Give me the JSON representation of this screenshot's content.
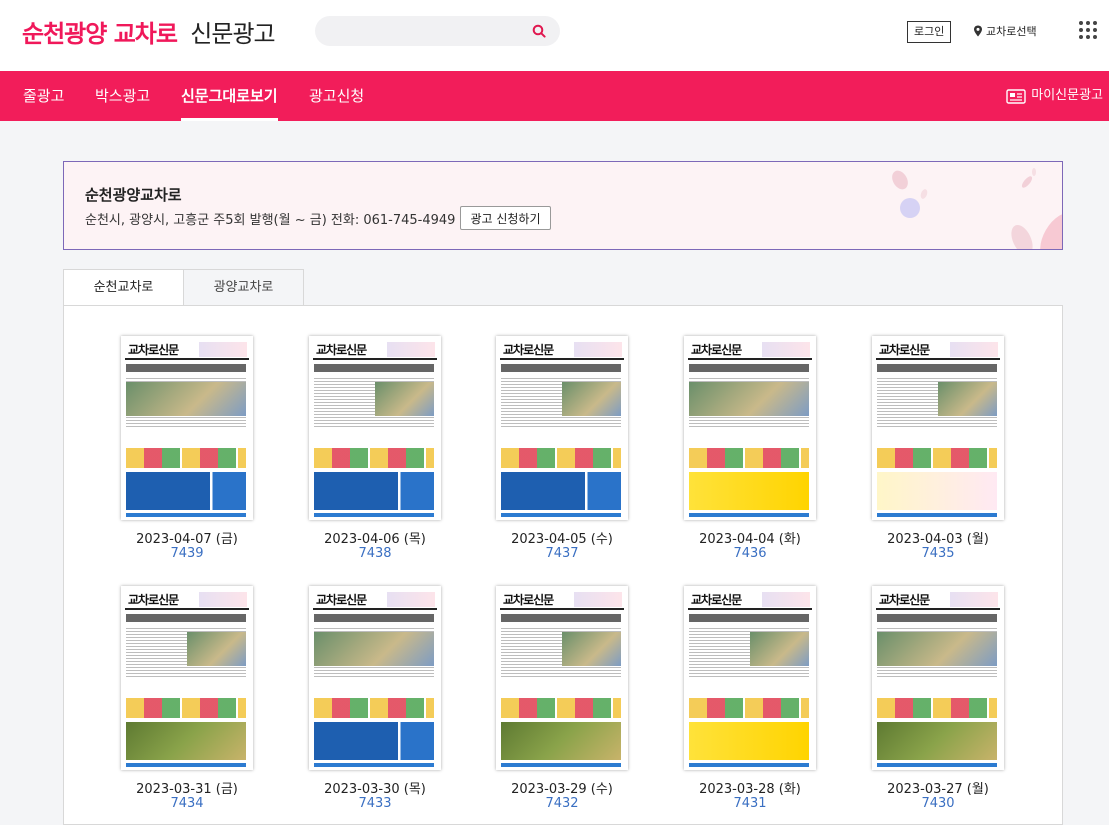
{
  "brand": {
    "part1": "순천광양",
    "part2": "교차로",
    "part3": "신문광고"
  },
  "search": {
    "placeholder": ""
  },
  "header": {
    "login_label": "로그인",
    "region_label": "교차로선택"
  },
  "nav": {
    "items": [
      "줄광고",
      "박스광고",
      "신문그대로보기",
      "광고신청"
    ],
    "active": "신문그대로보기",
    "my_ads_label": "마이신문광고"
  },
  "info": {
    "title": "순천광양교차로",
    "description": "순천시, 광양시, 고흥군 주5회 발행(월 ~ 금) 전화: 061-745-4949",
    "apply_label": "광고 신청하기"
  },
  "tabs": [
    {
      "label": "순천교차로",
      "active": true
    },
    {
      "label": "광양교차로",
      "active": false
    }
  ],
  "newspapers": [
    {
      "date": "2023-04-07 (금)",
      "issue": "7439",
      "masthead": "교차로신문",
      "ad_style": "blue"
    },
    {
      "date": "2023-04-06 (목)",
      "issue": "7438",
      "masthead": "교차로신문",
      "ad_style": "blue"
    },
    {
      "date": "2023-04-05 (수)",
      "issue": "7437",
      "masthead": "교차로신문",
      "ad_style": "blue"
    },
    {
      "date": "2023-04-04 (화)",
      "issue": "7436",
      "masthead": "교차로신문",
      "ad_style": "yel"
    },
    {
      "date": "2023-04-03 (월)",
      "issue": "7435",
      "masthead": "교차로신문",
      "ad_style": "fest"
    },
    {
      "date": "2023-03-31 (금)",
      "issue": "7434",
      "masthead": "교차로신문",
      "ad_style": "field"
    },
    {
      "date": "2023-03-30 (목)",
      "issue": "7433",
      "masthead": "교차로신문",
      "ad_style": "blue"
    },
    {
      "date": "2023-03-29 (수)",
      "issue": "7432",
      "masthead": "교차로신문",
      "ad_style": "field"
    },
    {
      "date": "2023-03-28 (화)",
      "issue": "7431",
      "masthead": "교차로신문",
      "ad_style": "yel"
    },
    {
      "date": "2023-03-27 (월)",
      "issue": "7430",
      "masthead": "교차로신문",
      "ad_style": "field"
    }
  ],
  "colors": {
    "brand_pink": "#f0185a",
    "nav_bg": "#f21d5a",
    "link_blue": "#3a6fc2"
  }
}
